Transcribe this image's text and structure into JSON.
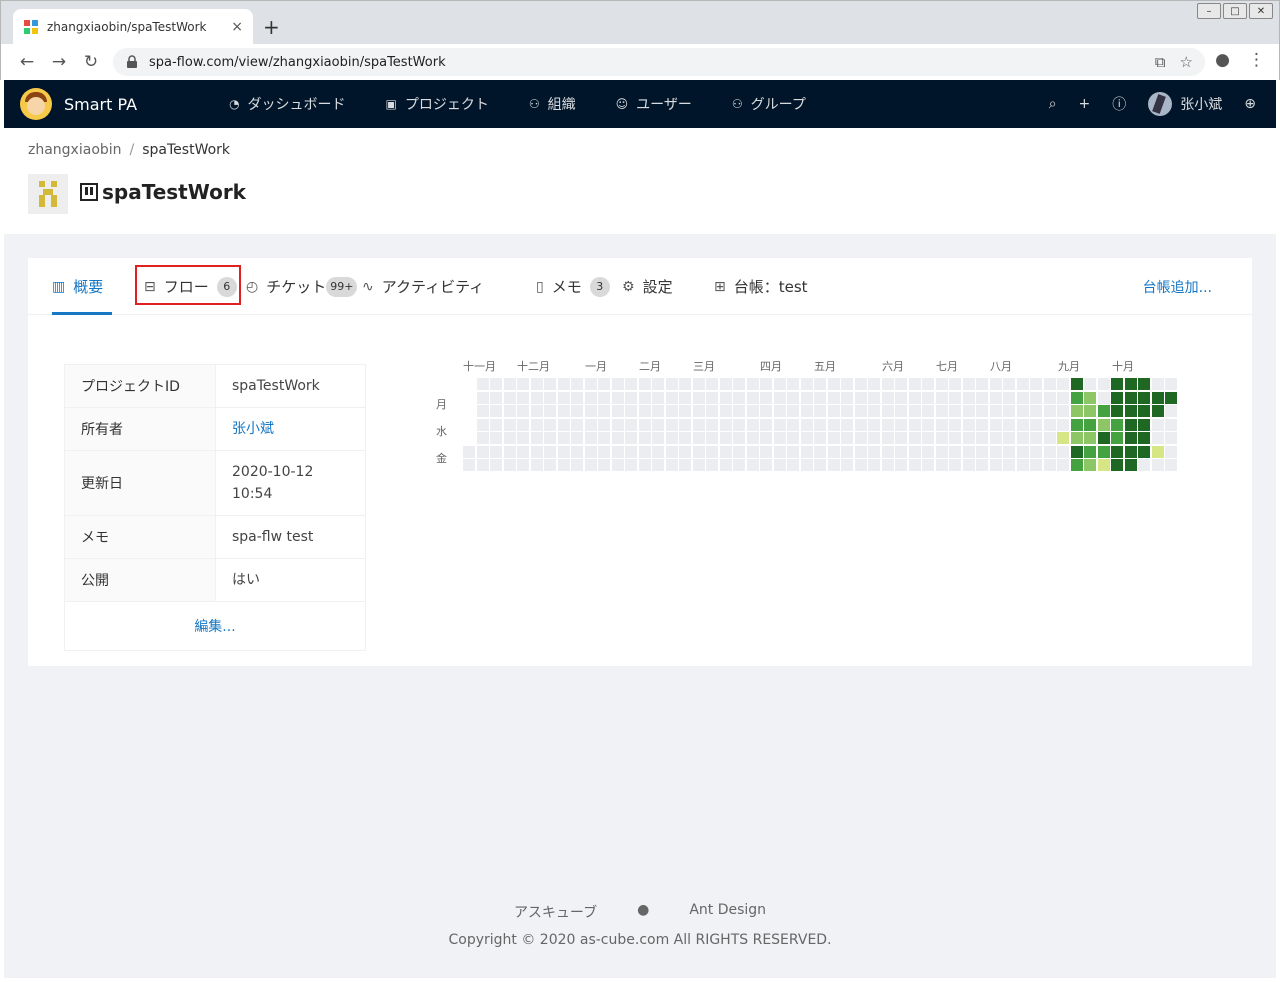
{
  "browser": {
    "tab_title": "zhangxiaobin/spaTestWork",
    "new_tab": "+",
    "close": "×",
    "url": "spa-flow.com/view/zhangxiaobin/spaTestWork"
  },
  "header": {
    "brand": "Smart PA",
    "menu": [
      "ダッシュボード",
      "プロジェクト",
      "組織",
      "ユーザー",
      "グループ"
    ],
    "user": "张小斌"
  },
  "breadcrumb": {
    "owner": "zhangxiaobin",
    "sep": "/",
    "project": "spaTestWork"
  },
  "project": {
    "title": "spaTestWork"
  },
  "tabs": [
    {
      "label": "概要",
      "badge": ""
    },
    {
      "label": "フロー",
      "badge": "6"
    },
    {
      "label": "チケット",
      "badge": "99+"
    },
    {
      "label": "アクティビティ",
      "badge": ""
    },
    {
      "label": "メモ",
      "badge": "3"
    },
    {
      "label": "設定",
      "badge": ""
    },
    {
      "label": "台帳：test",
      "badge": ""
    }
  ],
  "add_ledger": "台帳追加...",
  "info": {
    "rows": [
      {
        "key": "プロジェクトID",
        "value": "spaTestWork"
      },
      {
        "key": "所有者",
        "value": "张小斌"
      },
      {
        "key": "更新日",
        "value": "2020-10-12 10:54"
      },
      {
        "key": "メモ",
        "value": "spa-flw test"
      },
      {
        "key": "公開",
        "value": "はい"
      }
    ],
    "edit": "編集..."
  },
  "heatmap": {
    "months": [
      "十一月",
      "十二月",
      "一月",
      "二月",
      "三月",
      "四月",
      "五月",
      "六月",
      "七月",
      "八月",
      "九月",
      "十月"
    ],
    "days": [
      "月",
      "水",
      "金"
    ],
    "colors": [
      "#ebedf0",
      "#d6e685",
      "#8cc665",
      "#44a340",
      "#1e6823"
    ]
  },
  "footer": {
    "links": [
      "アスキューブ",
      "Ant Design"
    ],
    "copyright": "Copyright © 2020 as-cube.com All RIGHTS RESERVED."
  }
}
